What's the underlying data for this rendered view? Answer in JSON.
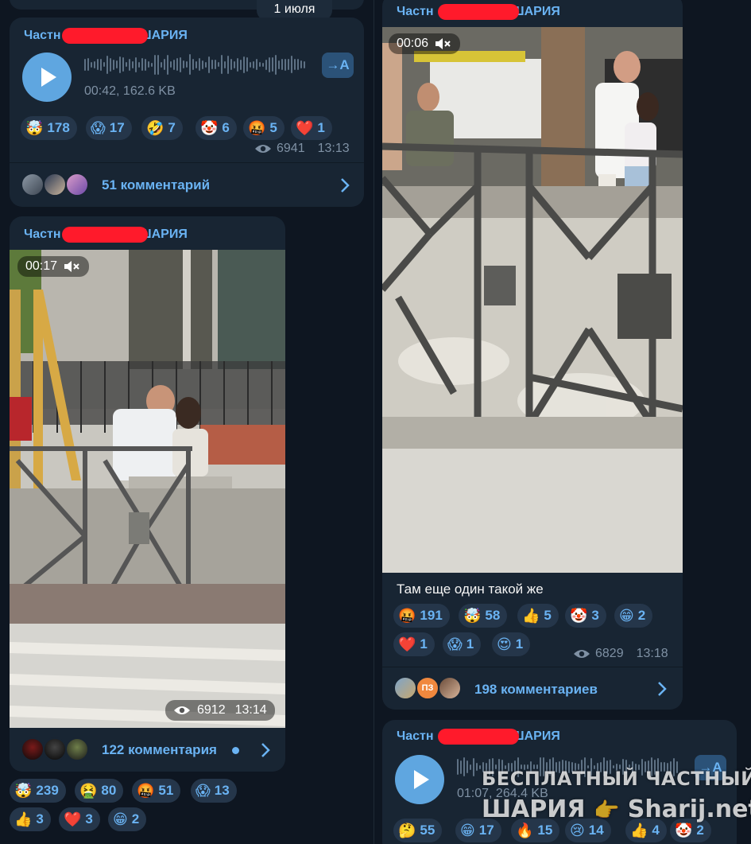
{
  "date_pill": "1 июля",
  "sender_prefix": "Частн",
  "sender_suffix": "ШАРИЯ",
  "post1": {
    "voice_meta": "00:42, 162.6 KB",
    "transcribe_label": "→A",
    "reactions": [
      {
        "emoji": "🤯",
        "count": "178"
      },
      {
        "emoji": "😱",
        "count": "17"
      },
      {
        "emoji": "🤣",
        "count": "7"
      },
      {
        "emoji": "🤡",
        "count": "6"
      },
      {
        "emoji": "🤬",
        "count": "5"
      },
      {
        "emoji": "❤️",
        "count": "1"
      }
    ],
    "views": "6941",
    "time": "13:13",
    "comments": "51 комментарий"
  },
  "post2": {
    "video_duration": "00:17",
    "views": "6912",
    "time": "13:14",
    "comments": "122 комментария",
    "reactions": [
      {
        "emoji": "🤯",
        "count": "239"
      },
      {
        "emoji": "🤮",
        "count": "80"
      },
      {
        "emoji": "🤬",
        "count": "51"
      },
      {
        "emoji": "😱",
        "count": "13"
      },
      {
        "emoji": "👍",
        "count": "3"
      },
      {
        "emoji": "❤️",
        "count": "3"
      },
      {
        "emoji": "😁",
        "count": "2"
      }
    ]
  },
  "post3": {
    "video_duration": "00:06",
    "caption": "Там еще один такой же",
    "reactions": [
      {
        "emoji": "🤬",
        "count": "191"
      },
      {
        "emoji": "🤯",
        "count": "58"
      },
      {
        "emoji": "👍",
        "count": "5"
      },
      {
        "emoji": "🤡",
        "count": "3"
      },
      {
        "emoji": "😁",
        "count": "2"
      },
      {
        "emoji": "❤️",
        "count": "1"
      },
      {
        "emoji": "😱",
        "count": "1"
      },
      {
        "emoji": "😍",
        "count": "1"
      }
    ],
    "views": "6829",
    "time": "13:18",
    "comments": "198 комментариев",
    "avatar_text": "ПЗ"
  },
  "post4": {
    "voice_meta": "01:07, 264.4 KB",
    "transcribe_label": "→A",
    "reactions": [
      {
        "emoji": "🤔",
        "count": "55"
      },
      {
        "emoji": "😁",
        "count": "17"
      },
      {
        "emoji": "🔥",
        "count": "15"
      },
      {
        "emoji": "😢",
        "count": "14"
      },
      {
        "emoji": "👍",
        "count": "4"
      },
      {
        "emoji": "🤡",
        "count": "2"
      }
    ]
  },
  "watermark": {
    "line1": "БЕСПЛАТНЫЙ ЧАСТНЫЙ",
    "line2a": "ШАРИЯ",
    "line2b": "Sharij.net"
  },
  "colors": {
    "background": "#0e1621",
    "bubble": "#182533",
    "accent": "#6ab3f3",
    "redaction": "#ff1a2b"
  }
}
